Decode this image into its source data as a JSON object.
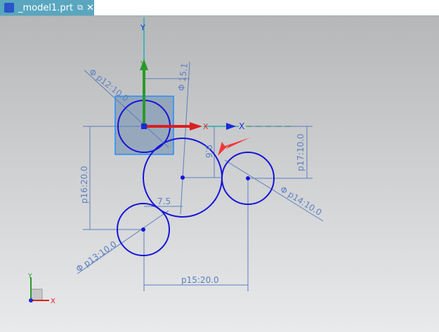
{
  "tab": {
    "title": "_model1.prt",
    "popout_icon": "popout-icon",
    "close_icon": "close-icon"
  },
  "axes": {
    "x": "X",
    "y": "Y"
  },
  "dimensions": {
    "d_p12": "Φ p12:10.0",
    "d_15": "Φ 15.1",
    "p16": "p16:20.0",
    "v96": "9.6",
    "p17": "p17:10.0",
    "h75": "7.5",
    "d_p14": "Φ p14:10.0",
    "d_p13": "Φ p13:10.0",
    "p15": "p15:20.0"
  },
  "colors": {
    "tab": "#5aa6bf",
    "curve": "#1515d8",
    "dimension": "#5b7fc0",
    "x_axis": "#e02020",
    "y_axis": "#2a9a2a",
    "arrow": "#f03030"
  }
}
